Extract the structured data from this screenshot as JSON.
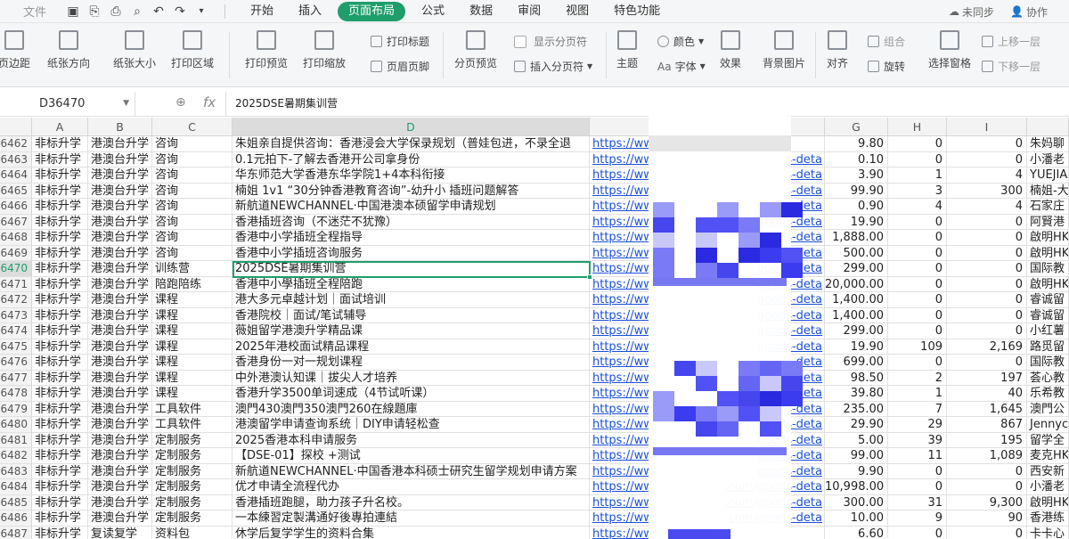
{
  "menubar": {
    "file": "文件",
    "tabs": [
      "开始",
      "插入",
      "页面布局",
      "公式",
      "数据",
      "审阅",
      "视图",
      "特色功能"
    ],
    "active_tab": "页面布局",
    "sync": "未同步",
    "collab": "协作"
  },
  "ribbon": {
    "margins": "页边距",
    "orientation": "纸张方向",
    "size": "纸张大小",
    "print_area": "打印区域",
    "print_preview": "打印预览",
    "print_scale": "打印缩放",
    "print_titles": "打印标题",
    "header_footer": "页眉页脚",
    "page_break_preview": "分页预览",
    "show_page_breaks": "显示分页符",
    "insert_page_break": "插入分页符",
    "theme": "主题",
    "colors": "颜色",
    "fonts": "字体",
    "effects": "效果",
    "background": "背景图片",
    "align": "对齐",
    "group": "组合",
    "rotate": "旋转",
    "selection_pane": "选择窗格",
    "bring_forward": "上移一层",
    "send_backward": "下移一层"
  },
  "formula_bar": {
    "cell_ref": "D36470",
    "fx": "fx",
    "content": "2025DSE暑期集训营"
  },
  "columns": [
    "A",
    "B",
    "C",
    "D",
    "",
    "",
    "G",
    "H",
    "I"
  ],
  "selected_column": "D",
  "selected_row": "6470",
  "rows": [
    {
      "n": "6462",
      "a": "非标升学",
      "b": "港澳台升学",
      "c": "咨询",
      "d": "朱姐亲自提供咨询：香港浸会大学保录规划（普娃包进，不录全退",
      "e": "https://ww",
      "f": "",
      "g": "9.80",
      "h": "0",
      "i": "0",
      "j": "朱妈聊"
    },
    {
      "n": "6463",
      "a": "非标升学",
      "b": "港澳台升学",
      "c": "咨询",
      "d": "0.1元拍下-了解去香港开公司拿身份",
      "e": "https://ww",
      "f": "s-deta",
      "g": "0.10",
      "h": "0",
      "i": "0",
      "j": "小潘老"
    },
    {
      "n": "6464",
      "a": "非标升学",
      "b": "港澳台升学",
      "c": "咨询",
      "d": "华东师范大学香港东华学院1+4本科衔接",
      "e": "https://ww",
      "f": "s-deta",
      "g": "3.90",
      "h": "1",
      "i": "4",
      "j": "YUEJIA"
    },
    {
      "n": "6465",
      "a": "非标升学",
      "b": "港澳台升学",
      "c": "咨询",
      "d": "楠姐 1v1 “30分钟香港教育咨询”-幼升小 插班问题解答",
      "e": "https://ww",
      "f": "s-deta",
      "g": "99.90",
      "h": "3",
      "i": "300",
      "j": "楠姐-大"
    },
    {
      "n": "6466",
      "a": "非标升学",
      "b": "港澳台升学",
      "c": "咨询",
      "d": "新航道NEWCHANNEL·中国港澳本硕留学申请规划",
      "e": "https://ww",
      "f": "goods-deta",
      "g": "0.90",
      "h": "4",
      "i": "4",
      "j": "石家庄"
    },
    {
      "n": "6467",
      "a": "非标升学",
      "b": "港澳台升学",
      "c": "咨询",
      "d": "香港插班咨询（不迷茫不犹豫）",
      "e": "https://ww",
      "f": "goods-deta",
      "g": "19.90",
      "h": "0",
      "i": "0",
      "j": "阿賢港"
    },
    {
      "n": "6468",
      "a": "非标升学",
      "b": "港澳台升学",
      "c": "咨询",
      "d": "香港中小学插班全程指导",
      "e": "https://ww",
      "f": "goods-deta",
      "g": "1,888.00",
      "h": "0",
      "i": "0",
      "j": "啟明HK"
    },
    {
      "n": "6469",
      "a": "非标升学",
      "b": "港澳台升学",
      "c": "咨询",
      "d": "香港中小学插班咨询服务",
      "e": "https://ww",
      "f": "goods-deta",
      "g": "500.00",
      "h": "0",
      "i": "0",
      "j": "啟明HK"
    },
    {
      "n": "6470",
      "a": "非标升学",
      "b": "港澳台升学",
      "c": "训练营",
      "d": "2025DSE暑期集训营",
      "e": "https://ww",
      "f": "goods-deta",
      "g": "299.00",
      "h": "0",
      "i": "0",
      "j": "国际教"
    },
    {
      "n": "6471",
      "a": "非标升学",
      "b": "港澳台升学",
      "c": "陪跑陪练",
      "d": "香港中小學插班全程陪跑",
      "e": "https://ww",
      "f": "goods-deta",
      "g": "20,000.00",
      "h": "0",
      "i": "0",
      "j": "啟明HK"
    },
    {
      "n": "6472",
      "a": "非标升学",
      "b": "港澳台升学",
      "c": "课程",
      "d": "港大多元卓越计划｜面试培训",
      "e": "https://ww",
      "f": "goods-deta",
      "g": "1,400.00",
      "h": "0",
      "i": "0",
      "j": "睿诚留"
    },
    {
      "n": "6473",
      "a": "非标升学",
      "b": "港澳台升学",
      "c": "课程",
      "d": "香港院校｜面试/笔试辅导",
      "e": "https://ww",
      "f": "goods-deta",
      "g": "1,400.00",
      "h": "0",
      "i": "0",
      "j": "睿诚留"
    },
    {
      "n": "6474",
      "a": "非标升学",
      "b": "港澳台升学",
      "c": "课程",
      "d": "薇姐留学港澳升学精品课",
      "e": "https://ww",
      "f": "goods-deta",
      "g": "299.00",
      "h": "0",
      "i": "0",
      "j": "小红薯"
    },
    {
      "n": "6475",
      "a": "非标升学",
      "b": "港澳台升学",
      "c": "课程",
      "d": "2025年港校面试精品课程",
      "e": "https://ww",
      "f": "goods-deta",
      "g": "19.90",
      "h": "109",
      "i": "2,169",
      "j": "路觅留"
    },
    {
      "n": "6476",
      "a": "非标升学",
      "b": "港澳台升学",
      "c": "课程",
      "d": "香港身份一对一规划课程",
      "e": "https://ww",
      "f": "goods-deta",
      "g": "699.00",
      "h": "0",
      "i": "0",
      "j": "国际教"
    },
    {
      "n": "6477",
      "a": "非标升学",
      "b": "港澳台升学",
      "c": "课程",
      "d": "中外港澳认知课｜拔尖人才培养",
      "e": "https://ww",
      "f": "goods-deta",
      "g": "98.50",
      "h": "2",
      "i": "197",
      "j": "荟心教"
    },
    {
      "n": "6478",
      "a": "非标升学",
      "b": "港澳台升学",
      "c": "课程",
      "d": "香港升学3500单词速成（4节试听课）",
      "e": "https://ww",
      "f": "goods-deta",
      "g": "39.80",
      "h": "1",
      "i": "40",
      "j": "乐希教"
    },
    {
      "n": "6479",
      "a": "非标升学",
      "b": "港澳台升学",
      "c": "工具软件",
      "d": "澳門430澳門350澳門260在線題庫",
      "e": "https://ww",
      "f": "goods-deta",
      "g": "235.00",
      "h": "7",
      "i": "1,645",
      "j": "澳門公"
    },
    {
      "n": "6480",
      "a": "非标升学",
      "b": "港澳台升学",
      "c": "工具软件",
      "d": "港澳留学申请查询系统｜DIY申请轻松查",
      "e": "https://ww",
      "f": "goods-deta",
      "g": "29.90",
      "h": "29",
      "i": "867",
      "j": "Jennyc"
    },
    {
      "n": "6481",
      "a": "非标升学",
      "b": "港澳台升学",
      "c": "定制服务",
      "d": "2025香港本科申请服务",
      "e": "https://ww",
      "f": "goods-deta",
      "g": "5.00",
      "h": "39",
      "i": "195",
      "j": "留学全"
    },
    {
      "n": "6482",
      "a": "非标升学",
      "b": "港澳台升学",
      "c": "定制服务",
      "d": "【DSE-01】探校 +测试",
      "e": "https://ww",
      "f": "goods-deta",
      "g": "99.00",
      "h": "11",
      "i": "1,089",
      "j": "麦克HK"
    },
    {
      "n": "6483",
      "a": "非标升学",
      "b": "港澳台升学",
      "c": "定制服务",
      "d": "新航道NEWCHANNEL·中国香港本科硕士研究生留学规划申请方案",
      "e": "https://ww",
      "f": "goods-deta",
      "g": "9.90",
      "h": "0",
      "i": "0",
      "j": "西安新"
    },
    {
      "n": "6484",
      "a": "非标升学",
      "b": "港澳台升学",
      "c": "定制服务",
      "d": "优才申请全流程代办",
      "e": "https://ww",
      "f": ".com/goods-deta",
      "g": "10,998.00",
      "h": "0",
      "i": "0",
      "j": "小潘老"
    },
    {
      "n": "6485",
      "a": "非标升学",
      "b": "港澳台升学",
      "c": "定制服务",
      "d": "香港插班跑腿，助力孩子升名校。",
      "e": "https://ww",
      "f": ".com/goods-deta",
      "g": "300.00",
      "h": "31",
      "i": "9,300",
      "j": "啟明HK"
    },
    {
      "n": "6486",
      "a": "非标升学",
      "b": "港澳台升学",
      "c": "定制服务",
      "d": "一本練習定製溝通好後專拍連結",
      "e": "https://ww",
      "f": ".com/goods-deta",
      "g": "10.00",
      "h": "9",
      "i": "90",
      "j": "香港练"
    },
    {
      "n": "6487",
      "a": "非标升学",
      "b": "复读复学",
      "c": "资料包",
      "d": "休学后复学学生的资料合集",
      "e": "https://ww",
      "f": "",
      "g": "6.60",
      "h": "0",
      "i": "0",
      "j": "卡卡心"
    }
  ]
}
